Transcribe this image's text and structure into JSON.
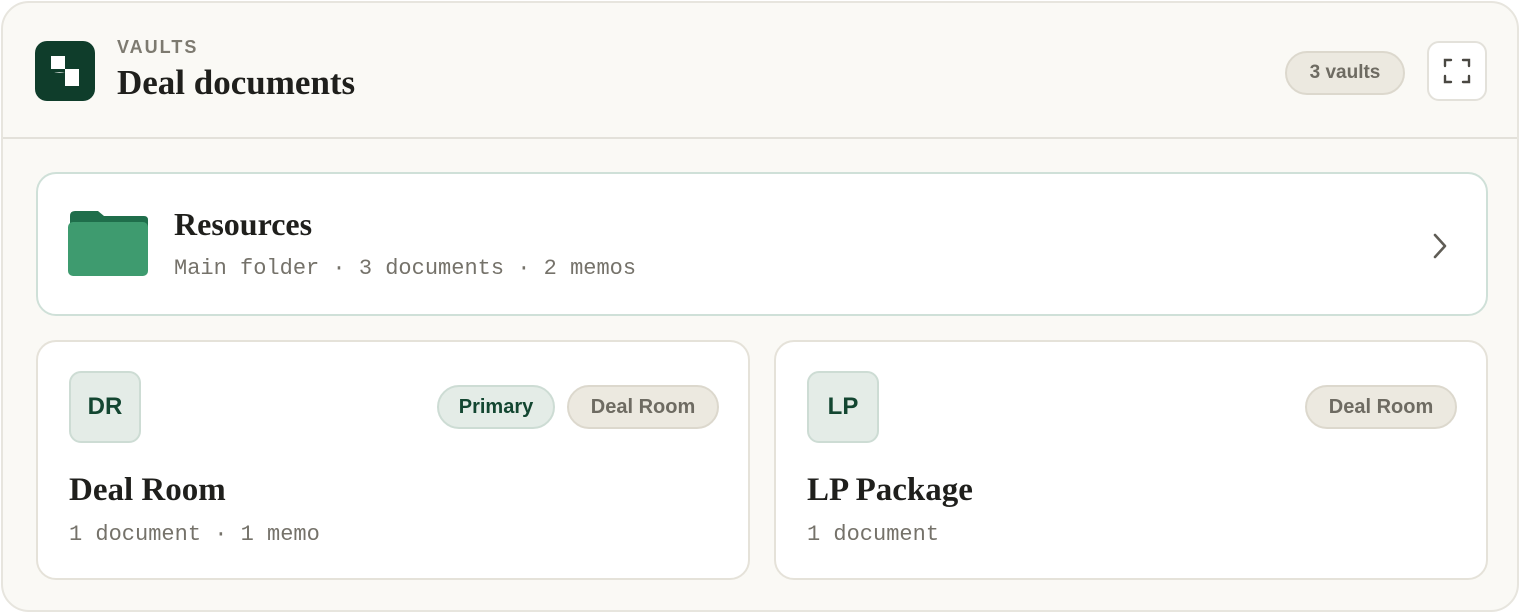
{
  "header": {
    "eyebrow": "VAULTS",
    "title": "Deal documents",
    "count": "3 vaults",
    "logo_icon": "vault-logo-icon",
    "expand_icon": "expand-icon"
  },
  "resources": {
    "icon": "folder-icon",
    "title": "Resources",
    "meta": "Main folder · 3 documents · 2 memos",
    "chevron_icon": "chevron-right-icon"
  },
  "vaults": [
    {
      "initials": "DR",
      "tags": [
        "Primary",
        "Deal Room"
      ],
      "title": "Deal Room",
      "meta": "1 document · 1 memo"
    },
    {
      "initials": "LP",
      "tags": [
        "Deal Room"
      ],
      "title": "LP Package",
      "meta": "1 document"
    }
  ],
  "colors": {
    "brand_dark": "#0f3d2b",
    "folder_green": "#3e9b6f",
    "panel_bg": "#faf9f5"
  }
}
